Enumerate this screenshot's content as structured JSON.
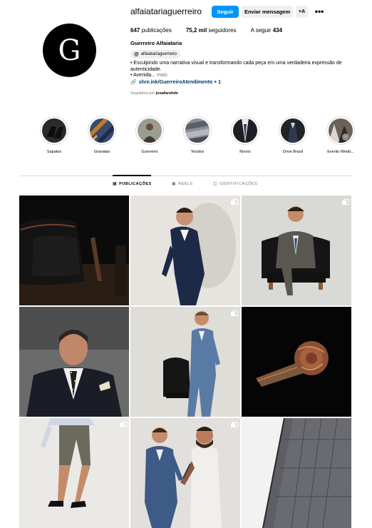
{
  "profile": {
    "avatar_letter": "G",
    "username": "alfaiatariaguerreiro",
    "follow_label": "Seguir",
    "message_label": "Enviar mensagem",
    "add_user_label": "+A",
    "more_label": "•••",
    "stats": {
      "posts_count": "647",
      "posts_label": "publicações",
      "followers_count": "75,2 mil",
      "followers_label": "seguidores",
      "following_label": "A seguir",
      "following_count": "434"
    },
    "full_name": "Guerreiro Alfaiataria",
    "threads_icon": "@",
    "threads_handle": "alfaiatariaguerreiro",
    "bio_line1": "• Esculpindo uma narrativa visual e transformando cada peça em uma verdadeira expressão de autenticidade.",
    "bio_line2": "• Avenida...",
    "bio_more": "mais",
    "link_icon": "🔗",
    "link_text": "shre.ink/GuerreiroAtendimento + 1",
    "followed_prefix": "Seguido/a por",
    "followed_by": "josafarohde"
  },
  "highlights": [
    {
      "label": "Sapatos"
    },
    {
      "label": "Gravatas"
    },
    {
      "label": "Guerreiro"
    },
    {
      "label": "Tecidos"
    },
    {
      "label": "Novos"
    },
    {
      "label": "Drive Brasil"
    },
    {
      "label": "Evento Wedd..."
    }
  ],
  "highlights_next_icon": "›",
  "tabs": [
    {
      "label": "PUBLICAÇÕES",
      "icon": "▦"
    },
    {
      "label": "REELS",
      "icon": "▣"
    },
    {
      "label": "IDENTIFICAÇÕES",
      "icon": "◫"
    }
  ],
  "colors": {
    "accent": "#0095f6",
    "link": "#00376b",
    "secondary_text": "#737373",
    "divider": "#dbdbdb"
  },
  "posts": [
    {
      "subject": "black leather shoe",
      "type": "single"
    },
    {
      "subject": "man in navy suit",
      "type": "carousel"
    },
    {
      "subject": "man in grey suit on leather armchair",
      "type": "carousel"
    },
    {
      "subject": "man in pinstripe suit with patterned tie",
      "type": "single"
    },
    {
      "subject": "man in blue three-piece suit by armchair",
      "type": "carousel"
    },
    {
      "subject": "rolled patterned tie",
      "type": "single"
    },
    {
      "subject": "man in shorts and loafers",
      "type": "carousel"
    },
    {
      "subject": "tailor adjusting blue suit",
      "type": "carousel"
    },
    {
      "subject": "grey checked suit fabric detail",
      "type": "single"
    }
  ]
}
